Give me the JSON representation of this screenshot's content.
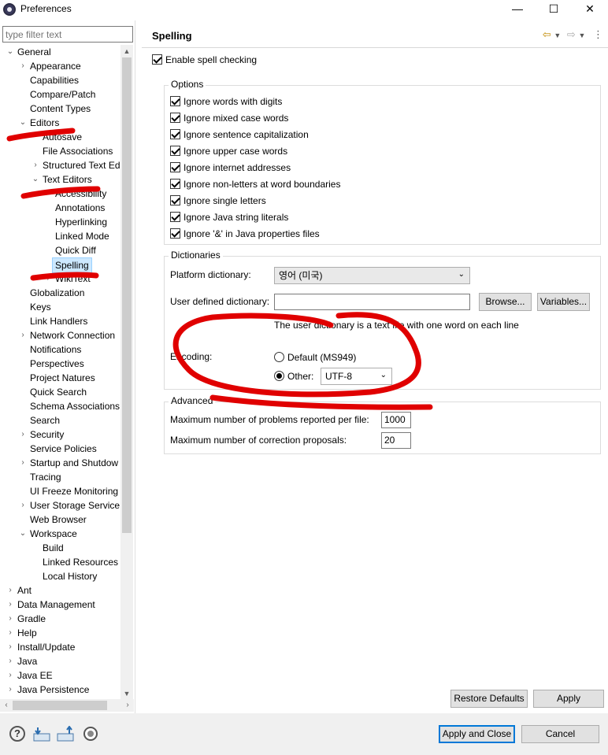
{
  "window": {
    "title": "Preferences",
    "minimize": "—",
    "maximize": "☐",
    "close": "✕"
  },
  "left": {
    "filter_placeholder": "type filter text",
    "tree": [
      {
        "label": "General",
        "arrow": "⌄",
        "level": 0
      },
      {
        "label": "Appearance",
        "arrow": "›",
        "level": 1
      },
      {
        "label": "Capabilities",
        "arrow": "",
        "level": 1
      },
      {
        "label": "Compare/Patch",
        "arrow": "",
        "level": 1
      },
      {
        "label": "Content Types",
        "arrow": "",
        "level": 1
      },
      {
        "label": "Editors",
        "arrow": "⌄",
        "level": 1
      },
      {
        "label": "Autosave",
        "arrow": "",
        "level": 2
      },
      {
        "label": "File Associations",
        "arrow": "",
        "level": 2
      },
      {
        "label": "Structured Text Ed",
        "arrow": "›",
        "level": 2
      },
      {
        "label": "Text Editors",
        "arrow": "⌄",
        "level": 2
      },
      {
        "label": "Accessibility",
        "arrow": "",
        "level": 3
      },
      {
        "label": "Annotations",
        "arrow": "",
        "level": 3
      },
      {
        "label": "Hyperlinking",
        "arrow": "",
        "level": 3
      },
      {
        "label": "Linked Mode",
        "arrow": "",
        "level": 3
      },
      {
        "label": "Quick Diff",
        "arrow": "",
        "level": 3
      },
      {
        "label": "Spelling",
        "arrow": "",
        "level": 3,
        "selected": true
      },
      {
        "label": "WikiText",
        "arrow": "›",
        "level": 3
      },
      {
        "label": "Globalization",
        "arrow": "",
        "level": 1
      },
      {
        "label": "Keys",
        "arrow": "",
        "level": 1
      },
      {
        "label": "Link Handlers",
        "arrow": "",
        "level": 1
      },
      {
        "label": "Network Connection",
        "arrow": "›",
        "level": 1
      },
      {
        "label": "Notifications",
        "arrow": "",
        "level": 1
      },
      {
        "label": "Perspectives",
        "arrow": "",
        "level": 1
      },
      {
        "label": "Project Natures",
        "arrow": "",
        "level": 1
      },
      {
        "label": "Quick Search",
        "arrow": "",
        "level": 1
      },
      {
        "label": "Schema Associations",
        "arrow": "",
        "level": 1
      },
      {
        "label": "Search",
        "arrow": "",
        "level": 1
      },
      {
        "label": "Security",
        "arrow": "›",
        "level": 1
      },
      {
        "label": "Service Policies",
        "arrow": "",
        "level": 1
      },
      {
        "label": "Startup and Shutdow",
        "arrow": "›",
        "level": 1
      },
      {
        "label": "Tracing",
        "arrow": "",
        "level": 1
      },
      {
        "label": "UI Freeze Monitoring",
        "arrow": "",
        "level": 1
      },
      {
        "label": "User Storage Service",
        "arrow": "›",
        "level": 1
      },
      {
        "label": "Web Browser",
        "arrow": "",
        "level": 1
      },
      {
        "label": "Workspace",
        "arrow": "⌄",
        "level": 1
      },
      {
        "label": "Build",
        "arrow": "",
        "level": 2
      },
      {
        "label": "Linked Resources",
        "arrow": "",
        "level": 2
      },
      {
        "label": "Local History",
        "arrow": "",
        "level": 2
      },
      {
        "label": "Ant",
        "arrow": "›",
        "level": 0
      },
      {
        "label": "Data Management",
        "arrow": "›",
        "level": 0
      },
      {
        "label": "Gradle",
        "arrow": "›",
        "level": 0
      },
      {
        "label": "Help",
        "arrow": "›",
        "level": 0
      },
      {
        "label": "Install/Update",
        "arrow": "›",
        "level": 0
      },
      {
        "label": "Java",
        "arrow": "›",
        "level": 0
      },
      {
        "label": "Java EE",
        "arrow": "›",
        "level": 0
      },
      {
        "label": "Java Persistence",
        "arrow": "›",
        "level": 0
      }
    ]
  },
  "right": {
    "title": "Spelling",
    "enable": {
      "label": "Enable spell checking",
      "checked": true
    },
    "options": {
      "title": "Options",
      "items": [
        {
          "label": "Ignore words with digits",
          "checked": true
        },
        {
          "label": "Ignore mixed case words",
          "checked": true
        },
        {
          "label": "Ignore sentence capitalization",
          "checked": true
        },
        {
          "label": "Ignore upper case words",
          "checked": true
        },
        {
          "label": "Ignore internet addresses",
          "checked": true
        },
        {
          "label": "Ignore non-letters at word boundaries",
          "checked": true
        },
        {
          "label": "Ignore single letters",
          "checked": true
        },
        {
          "label": "Ignore Java string literals",
          "checked": true
        },
        {
          "label": "Ignore '&' in Java properties files",
          "checked": true
        }
      ]
    },
    "dictionaries": {
      "title": "Dictionaries",
      "platform_label": "Platform dictionary:",
      "platform_value": "영어 (미국)",
      "user_label": "User defined dictionary:",
      "user_value": "",
      "browse": "Browse...",
      "variables": "Variables...",
      "hint": "The user dictionary is a text file with one word on each line",
      "encoding_label": "Encoding:",
      "default_option": "Default (MS949)",
      "other_option": "Other:",
      "other_value": "UTF-8",
      "selected_encoding": "Other"
    },
    "advanced": {
      "title": "Advanced",
      "max_problems_label": "Maximum number of problems reported per file:",
      "max_problems_value": "1000",
      "max_proposals_label": "Maximum number of correction proposals:",
      "max_proposals_value": "20"
    },
    "restore_defaults": "Restore Defaults",
    "apply": "Apply"
  },
  "bottom": {
    "apply_and_close": "Apply and Close",
    "cancel": "Cancel"
  },
  "colors": {
    "annotation": "#e00000",
    "selection": "#cce8ff",
    "accent": "#0078d7"
  },
  "icons": [
    "app-icon",
    "back-arrow-icon",
    "forward-arrow-icon",
    "menu-icon",
    "help-icon",
    "import-icon",
    "export-icon",
    "oomph-icon"
  ]
}
